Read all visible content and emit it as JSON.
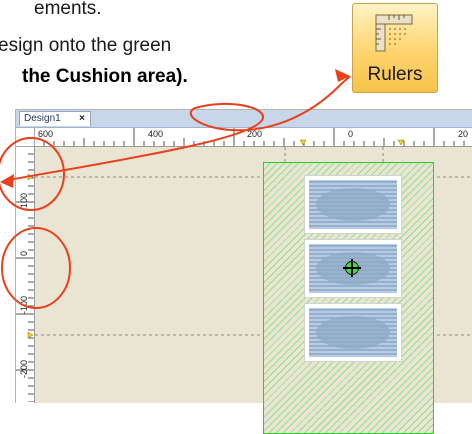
{
  "instructions": {
    "line1": "ements.",
    "line2": "esign onto the green",
    "line3": "the Cushion area)."
  },
  "ribbon": {
    "rulers_label": "Rulers",
    "rulers_icon": "rulers-icon"
  },
  "design_window": {
    "tab_label": "Design1",
    "tab_close": "×",
    "h_ruler_labels": [
      "600",
      "400",
      "200",
      "0",
      "20"
    ],
    "v_ruler_labels": [
      "100",
      "0",
      "-100",
      "-200"
    ]
  },
  "colors": {
    "annotation": "#e8401a",
    "hoop_border": "#24d424",
    "canvas": "#eae4d2",
    "ribbon_button": "#ffd46e"
  }
}
